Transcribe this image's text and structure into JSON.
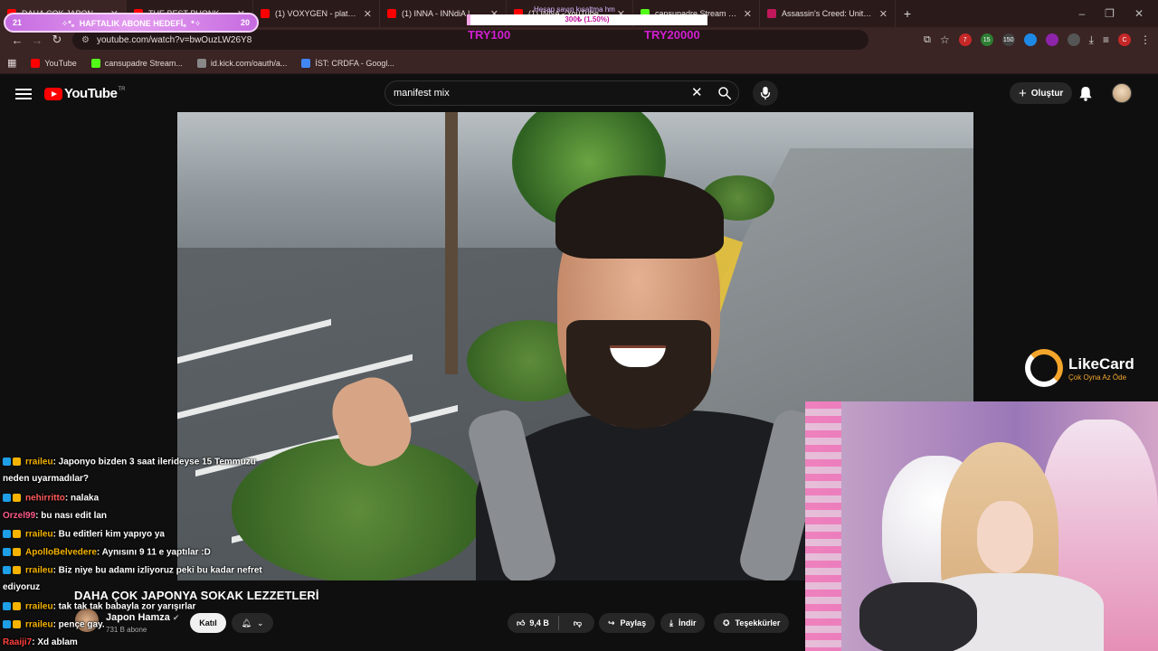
{
  "tabs": [
    {
      "label": "DAHA ÇOK JAPONYA SOKAK",
      "active": true,
      "color": "#ff0000"
    },
    {
      "label": "THE BEST PHONK PLAYLIST",
      "active": false,
      "color": "#ff0000"
    },
    {
      "label": "(1) VOXYGEN - plateau (ar",
      "active": false,
      "color": "#ff0000"
    },
    {
      "label": "(1) INNA - INNdiA | Rock",
      "active": false,
      "color": "#ff0000"
    },
    {
      "label": "(1) INNA - YouTube",
      "active": false,
      "color": "#ff0000"
    },
    {
      "label": "cansupadre Stream - Watch Li",
      "active": false,
      "color": "#53fc18"
    },
    {
      "label": "Assassin's Creed: Unity Türkçe",
      "active": false,
      "color": "#c2185b"
    }
  ],
  "address": {
    "url": "youtube.com/watch?v=bwOuzLW26Y8"
  },
  "bookmarks": [
    {
      "label": "YouTube",
      "color": "#ff0000"
    },
    {
      "label": "cansupadre Stream...",
      "color": "#53fc18"
    },
    {
      "label": "id.kick.com/oauth/a...",
      "color": "#888888"
    },
    {
      "label": "İST: CRDFA - Googl...",
      "color": "#4285f4"
    }
  ],
  "extensions": [
    {
      "name": "extension-badge-7",
      "label": "7",
      "color": "#c62828"
    },
    {
      "name": "extension-badge-15",
      "label": "15",
      "color": "#2e7d32"
    },
    {
      "name": "extension-badge-150",
      "label": "150",
      "color": "#424242"
    },
    {
      "name": "extension-blue",
      "label": "",
      "color": "#1e88e5"
    },
    {
      "name": "extension-purple",
      "label": "",
      "color": "#8e24aa"
    },
    {
      "name": "extension-puzzle",
      "label": "",
      "color": "#555555"
    }
  ],
  "overlay": {
    "goal_current": "21",
    "goal_title": "✧*。HAFTALIK ABONE HEDEFİ。*✧",
    "goal_target": "20",
    "donation_ticker": "Hesap sayın kısaltma hm",
    "donation_progress": "300₺ (1.50%)",
    "donation_fraction": 0.015,
    "try_min": "TRY100",
    "try_max": "TRY20000"
  },
  "youtube": {
    "logo": "YouTube",
    "logo_country": "TR",
    "search_value": "manifest mix",
    "create_label": "Oluştur"
  },
  "sponsor": {
    "name": "LikeCard",
    "tagline": "Çok Oyna Az Öde"
  },
  "chat": [
    {
      "user": "rraileu",
      "text": ": Japonyo bizden 3 saat ilerideyse 15 Temmuzu neden uyarmadılar?",
      "color": "#f5b300",
      "badges": 2
    },
    {
      "user": "nehirritto",
      "text": ": nalaka",
      "color": "#ff5a5a",
      "badges": 2
    },
    {
      "user": "Orzel99",
      "text": ": bu nası edit lan",
      "color": "#ff5a8a",
      "badges": 0
    },
    {
      "user": "rraileu",
      "text": ": Bu editleri kim yapıyo ya",
      "color": "#f5b300",
      "badges": 2
    },
    {
      "user": "ApolloBelvedere",
      "text": ": Aynısını 9 11 e yaptılar :D",
      "color": "#f5b300",
      "badges": 2
    },
    {
      "user": "rraileu",
      "text": ": Biz niye bu adamı izliyoruz peki bu kadar nefret ediyoruz",
      "color": "#f5b300",
      "badges": 2
    },
    {
      "user": "rraileu",
      "text": ": tak tak tak babayla zor yarışırlar",
      "color": "#f5b300",
      "badges": 2
    },
    {
      "user": "rraileu",
      "text": ": pençe gay.",
      "color": "#f5b300",
      "badges": 2
    },
    {
      "user": "Raaiji7",
      "text": ": Xd ablam",
      "color": "#ff4040",
      "badges": 0
    }
  ],
  "video": {
    "title": "DAHA ÇOK JAPONYA SOKAK LEZZETLERİ",
    "channel": "Japon Hamza",
    "subs": "731 B abone",
    "join_label": "Katıl",
    "likes": "9,4 B",
    "share_label": "Paylaş",
    "download_label": "İndir",
    "thanks_label": "Teşekkürler"
  }
}
